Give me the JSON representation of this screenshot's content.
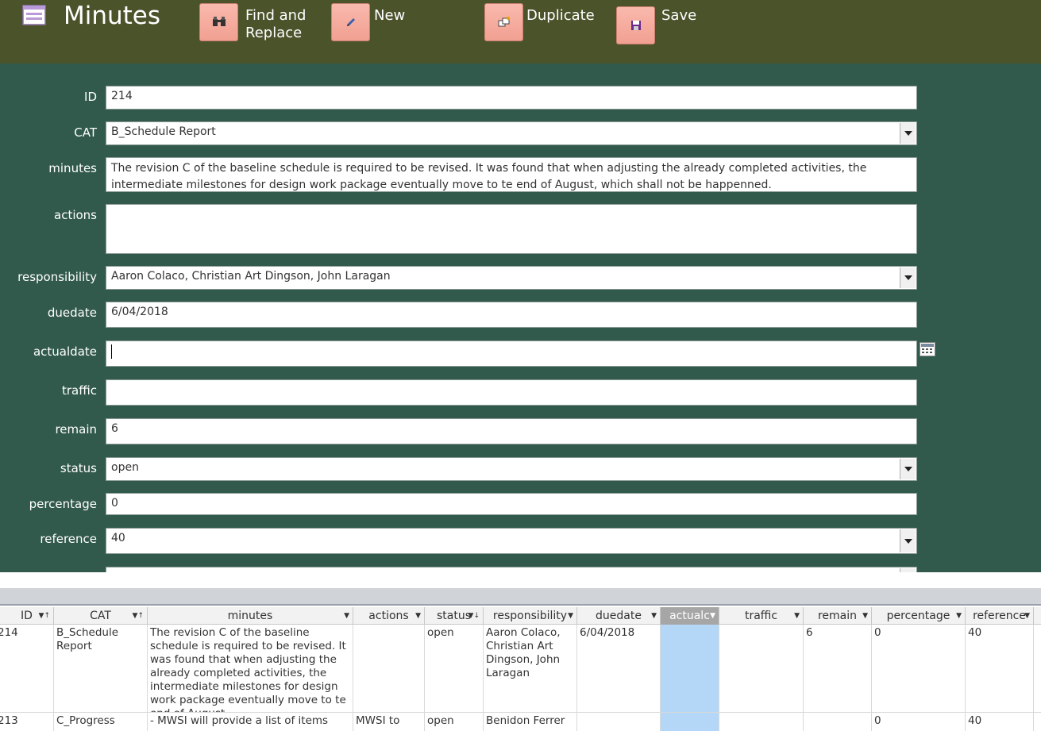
{
  "header": {
    "title": "Minutes",
    "buttons": {
      "find_replace": "Find and Replace",
      "find_line1": "Find and",
      "find_line2": "Replace",
      "new": "New",
      "duplicate": "Duplicate",
      "save": "Save"
    }
  },
  "form": {
    "labels": {
      "id": "ID",
      "cat": "CAT",
      "minutes": "minutes",
      "actions": "actions",
      "responsibility": "responsibility",
      "duedate": "duedate",
      "actualdate": "actualdate",
      "traffic": "traffic",
      "remain": "remain",
      "status": "status",
      "percentage": "percentage",
      "reference": "reference"
    },
    "values": {
      "id": "214",
      "cat": "B_Schedule Report",
      "minutes": "The revision C of the baseline schedule is required to be revised. It was found that when adjusting the already completed activities, the intermediate milestones for design work package eventually move to te end of August, which shall not be happenned.",
      "actions": "",
      "responsibility": "Aaron Colaco, Christian Art Dingson, John Laragan",
      "duedate": "6/04/2018",
      "actualdate": "",
      "traffic": "",
      "remain": "6",
      "status": "open",
      "percentage": "0",
      "reference": "40"
    }
  },
  "datasheet": {
    "columns": [
      "ID",
      "CAT",
      "minutes",
      "actions",
      "status",
      "responsibility",
      "duedate",
      "actualc",
      "traffic",
      "remain",
      "percentage",
      "reference"
    ],
    "rows": [
      {
        "id": "214",
        "cat": "B_Schedule Report",
        "minutes": "The revision C of the baseline schedule is required to be revised. It was found that when adjusting the already completed activities, the intermediate milestones for design work package eventually move to te end of August,",
        "actions": "",
        "status": "open",
        "responsibility": "Aaron Colaco, Christian Art Dingson, John Laragan",
        "duedate": "6/04/2018",
        "actualdate": "",
        "traffic": "",
        "remain": "6",
        "percentage": "0",
        "reference": "40"
      },
      {
        "id": "213",
        "cat": "C_Progress",
        "minutes": "- MWSI will provide a list of items",
        "actions": "MWSI to",
        "status": "open",
        "responsibility": "Benidon Ferrer",
        "duedate": "",
        "actualdate": "",
        "traffic": "",
        "remain": "",
        "percentage": "0",
        "reference": "40"
      }
    ]
  },
  "icons": {
    "form": "form-icon",
    "find": "binoculars-icon",
    "new": "pencil-icon",
    "duplicate": "duplicate-icon",
    "save": "floppy-disk-icon",
    "calendar": "calendar-icon"
  },
  "colors": {
    "header_bg": "#4b532b",
    "form_bg": "#325a4c",
    "button_bg": "#f6ad9f",
    "selection": "#b4d6f7"
  }
}
